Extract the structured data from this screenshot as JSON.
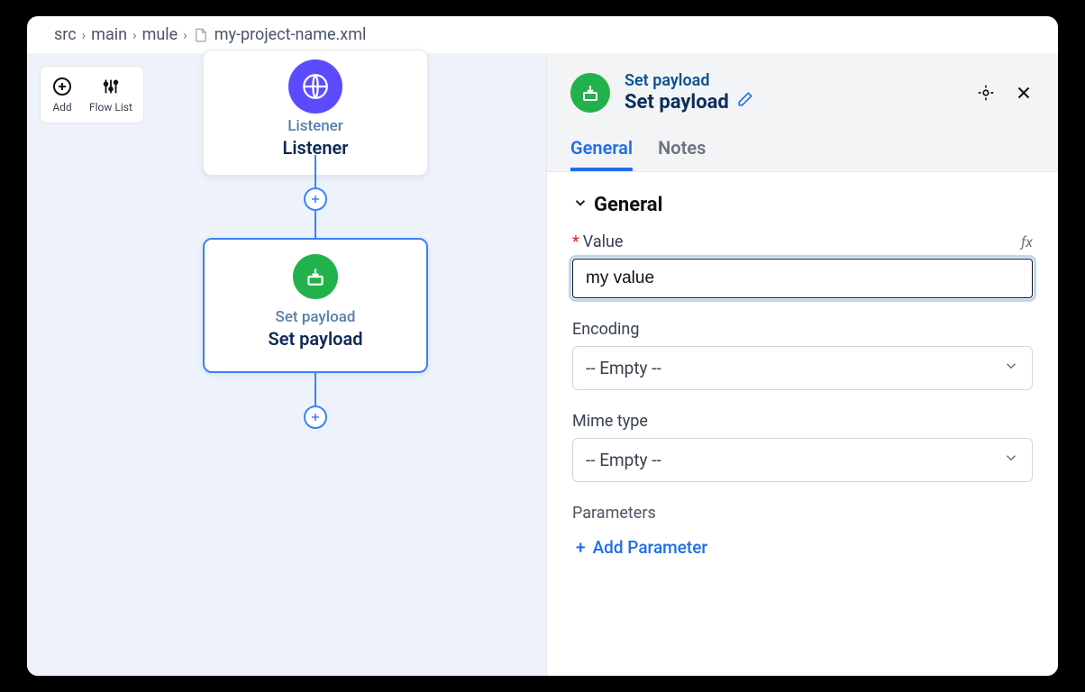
{
  "breadcrumb": {
    "parts": [
      "src",
      "main",
      "mule"
    ],
    "file": "my-project-name.xml"
  },
  "toolbar": {
    "add_label": "Add",
    "flow_list_label": "Flow List"
  },
  "flow": {
    "listener": {
      "type_label": "Listener",
      "name": "Listener"
    },
    "set_payload": {
      "type_label": "Set payload",
      "name": "Set payload"
    }
  },
  "panel": {
    "subtitle": "Set payload",
    "title": "Set payload",
    "tabs": {
      "general": "General",
      "notes": "Notes"
    },
    "section_general": "General",
    "fields": {
      "value": {
        "label": "Value",
        "value": "my value"
      },
      "encoding": {
        "label": "Encoding",
        "value": "-- Empty --"
      },
      "mime": {
        "label": "Mime type",
        "value": "-- Empty --"
      }
    },
    "parameters_label": "Parameters",
    "add_parameter": "Add Parameter"
  }
}
